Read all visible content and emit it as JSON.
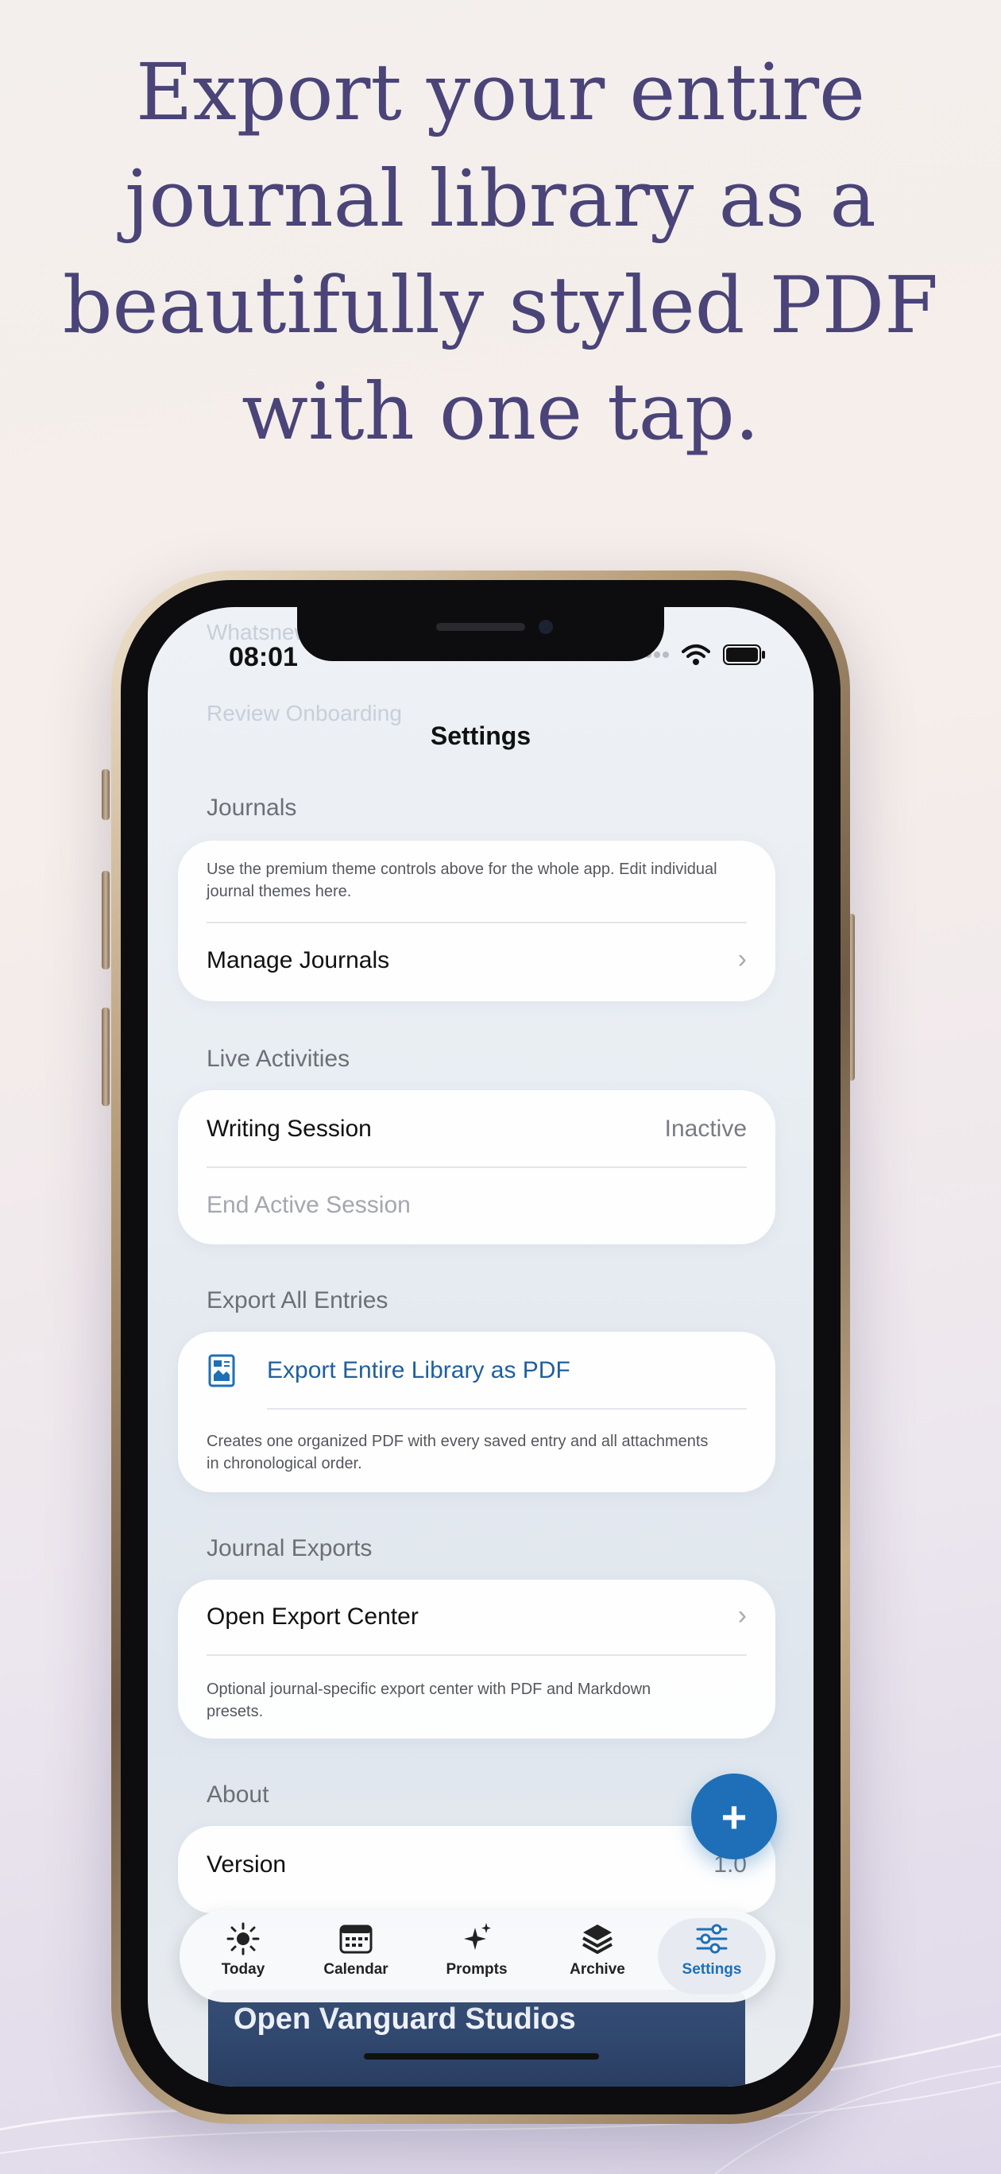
{
  "headline": "Export your entire journal library as a beautifully styled PDF with one tap.",
  "status_bar": {
    "time": "08:01"
  },
  "ghost": {
    "line1": "Whatsnew",
    "line2": "Review Onboarding"
  },
  "nav": {
    "title": "Settings"
  },
  "journals": {
    "header": "Journals",
    "note": "Use the premium theme controls above for the whole app. Edit individual journal themes here.",
    "manage_label": "Manage Journals"
  },
  "live_activities": {
    "header": "Live Activities",
    "writing_session_label": "Writing Session",
    "writing_session_value": "Inactive",
    "end_session_label": "End Active Session"
  },
  "export_all": {
    "header": "Export All Entries",
    "button_label": "Export Entire Library as PDF",
    "note": "Creates one organized PDF with every saved entry and all attachments in chronological order."
  },
  "journal_exports": {
    "header": "Journal Exports",
    "open_label": "Open Export Center",
    "note": "Optional journal-specific export center with PDF and Markdown presets."
  },
  "about": {
    "header": "About",
    "version_label": "Version",
    "version_value": "1.0"
  },
  "fab": {
    "symbol": "+"
  },
  "banner": {
    "text": "Open Vanguard Studios"
  },
  "tabs": [
    {
      "label": "Today",
      "icon": "sun-icon"
    },
    {
      "label": "Calendar",
      "icon": "calendar-icon"
    },
    {
      "label": "Prompts",
      "icon": "sparkles-icon"
    },
    {
      "label": "Archive",
      "icon": "layers-icon"
    },
    {
      "label": "Settings",
      "icon": "sliders-icon",
      "active": true
    }
  ],
  "colors": {
    "headline": "#4a4478",
    "accent": "#1e6fb7",
    "banner": "#2f4670"
  }
}
